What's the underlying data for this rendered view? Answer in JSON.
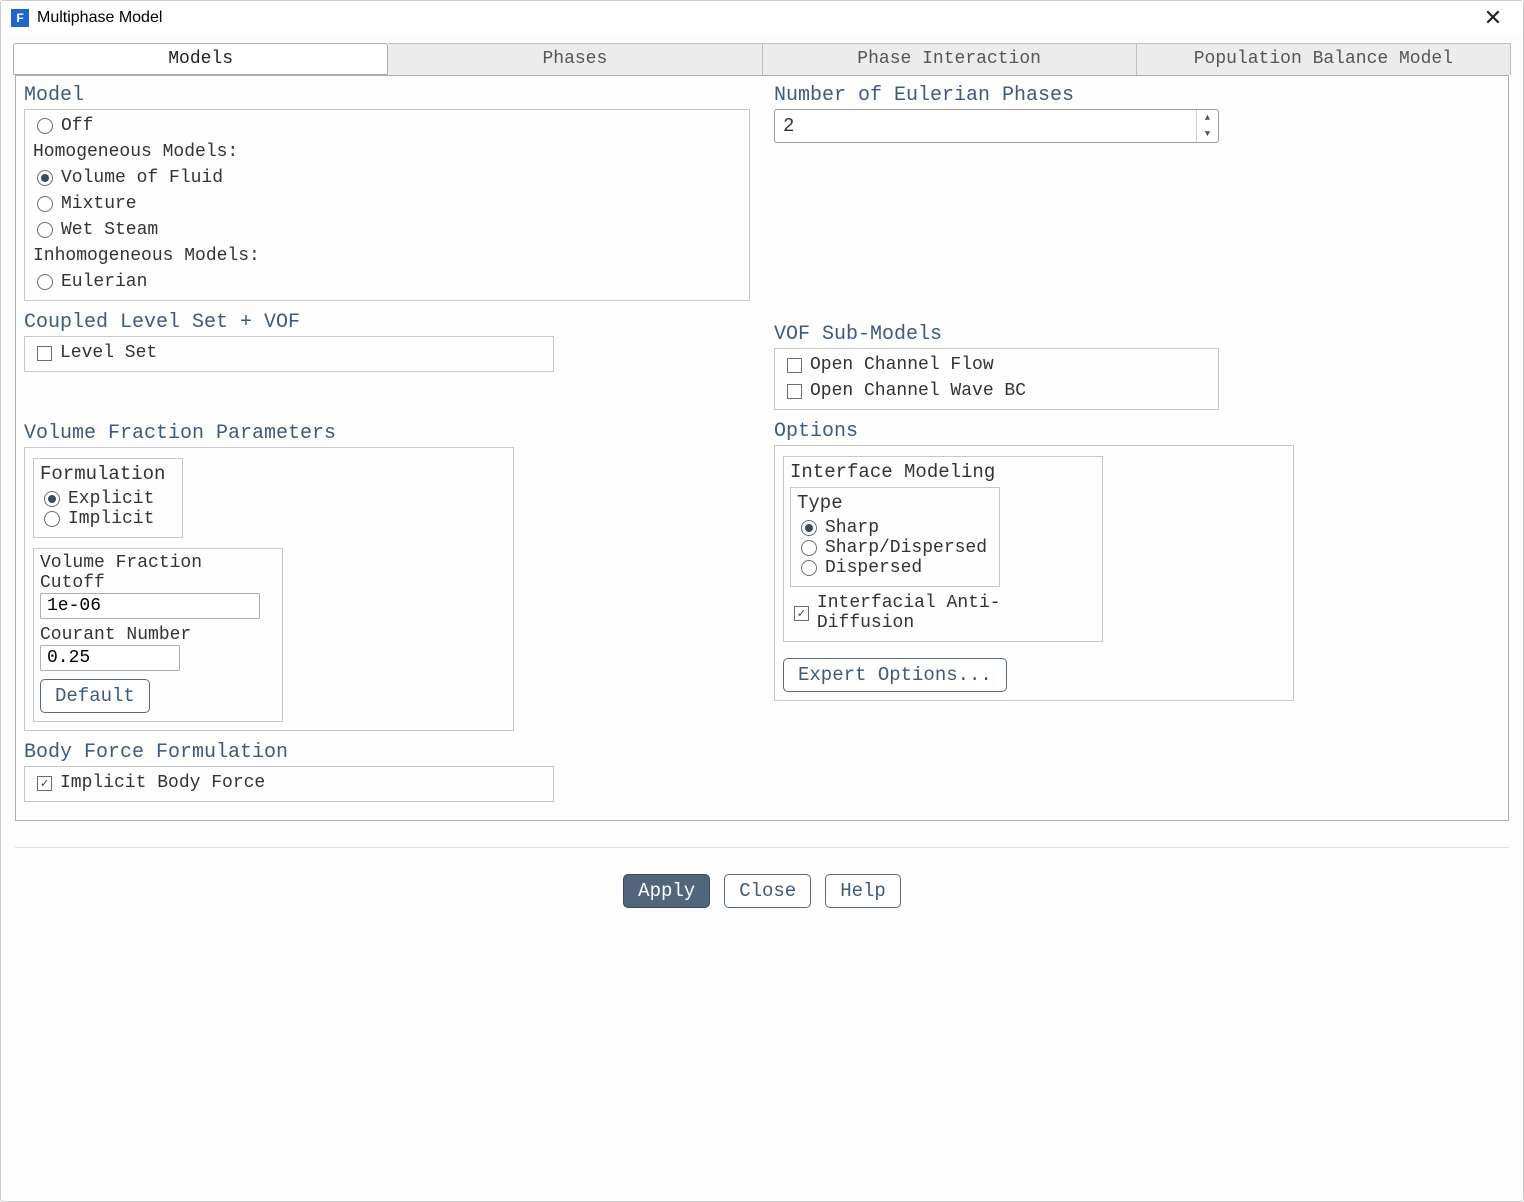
{
  "window": {
    "title": "Multiphase Model",
    "close_icon": "✕"
  },
  "tabs": {
    "items": [
      {
        "label": "Models"
      },
      {
        "label": "Phases"
      },
      {
        "label": "Phase Interaction"
      },
      {
        "label": "Population Balance Model"
      }
    ]
  },
  "left": {
    "model": {
      "title": "Model",
      "off": "Off",
      "homog_header": "Homogeneous Models:",
      "vof": "Volume of Fluid",
      "mixture": "Mixture",
      "wetsteam": "Wet Steam",
      "inhomog_header": "Inhomogeneous Models:",
      "eulerian": "Eulerian"
    },
    "coupled": {
      "title": "Coupled Level Set + VOF",
      "level_set": "Level Set"
    },
    "vfrac": {
      "title": "Volume Fraction Parameters",
      "formulation_title": "Formulation",
      "explicit": "Explicit",
      "implicit": "Implicit",
      "cutoff_label": "Volume Fraction Cutoff",
      "cutoff_value": "1e-06",
      "courant_label": "Courant Number",
      "courant_value": "0.25",
      "default_btn": "Default"
    },
    "body": {
      "title": "Body Force Formulation",
      "implicit_body": "Implicit Body Force"
    }
  },
  "right": {
    "phases": {
      "title": "Number of Eulerian Phases",
      "value": "2"
    },
    "vofsub": {
      "title": "VOF Sub-Models",
      "open_channel": "Open Channel Flow",
      "wave_bc": "Open Channel Wave BC"
    },
    "options": {
      "title": "Options",
      "iface": {
        "title": "Interface Modeling",
        "type_title": "Type",
        "sharp": "Sharp",
        "sharp_disp": "Sharp/Dispersed",
        "dispersed": "Dispersed",
        "anti_diff": "Interfacial Anti-Diffusion"
      },
      "expert_btn": "Expert Options..."
    }
  },
  "actions": {
    "apply": "Apply",
    "close": "Close",
    "help": "Help"
  }
}
